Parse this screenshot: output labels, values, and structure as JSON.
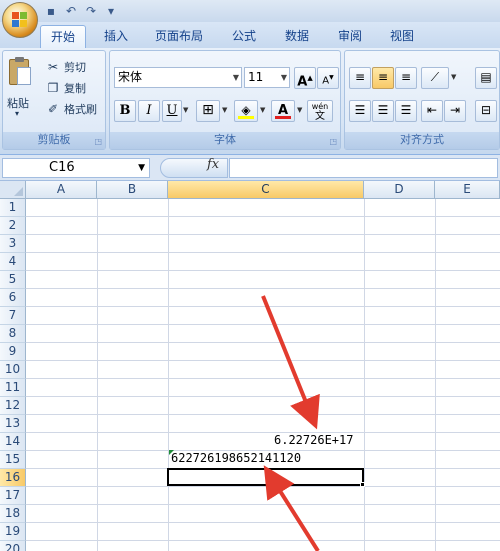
{
  "tabs": [
    {
      "label": "开始",
      "active": true
    },
    {
      "label": "插入"
    },
    {
      "label": "页面布局"
    },
    {
      "label": "公式"
    },
    {
      "label": "数据"
    },
    {
      "label": "审阅"
    },
    {
      "label": "视图"
    }
  ],
  "clipboard": {
    "paste_label": "粘贴",
    "cut_label": "剪切",
    "copy_label": "复制",
    "format_painter_label": "格式刷",
    "group_label": "剪贴板"
  },
  "font": {
    "font_name": "宋体",
    "font_size": "11",
    "bold": "B",
    "italic": "I",
    "underline": "U",
    "font_color_glyph": "A",
    "phonetic_top": "wén",
    "phonetic_bottom": "文",
    "grow": "A",
    "shrink": "A",
    "group_label": "字体"
  },
  "alignment": {
    "group_label": "对齐方式"
  },
  "formula_bar": {
    "name_box": "C16",
    "fx_label": "fx",
    "value": ""
  },
  "grid": {
    "columns": [
      "A",
      "B",
      "C",
      "D",
      "E"
    ],
    "selected_column": "C",
    "rows": [
      "1",
      "2",
      "3",
      "4",
      "5",
      "6",
      "7",
      "8",
      "9",
      "10",
      "11",
      "12",
      "13",
      "14",
      "15",
      "16",
      "17",
      "18",
      "19",
      "20"
    ],
    "selected_row": "16",
    "cells": {
      "C14": "6.22726E+17",
      "C15": "622726198652141120"
    }
  },
  "colors": {
    "accent": "#f8c967",
    "arrow": "#e23b2e",
    "ribbon": "#dbe7f6"
  }
}
